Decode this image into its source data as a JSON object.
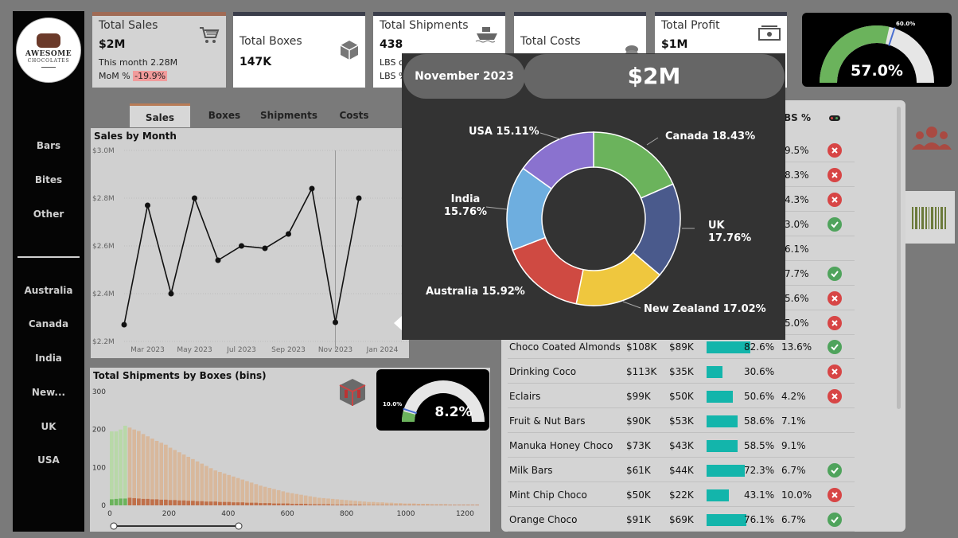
{
  "logo": {
    "line1": "AWESOME",
    "line2": "CHOCOLATES"
  },
  "nav": {
    "products": [
      "Bars",
      "Bites",
      "Other"
    ],
    "countries": [
      "Australia",
      "Canada",
      "India",
      "New...",
      "UK",
      "USA"
    ]
  },
  "kpis": {
    "sales": {
      "title": "Total Sales",
      "value": "$2M",
      "sub1": "This month 2.28M",
      "sub2_label": "MoM %",
      "sub2_value": "-19.9%"
    },
    "boxes": {
      "title": "Total Boxes",
      "value": "147K"
    },
    "shipments": {
      "title": "Total Shipments",
      "value": "438",
      "sub1": "LBS c",
      "sub2": "LBS %"
    },
    "costs": {
      "title": "Total Costs"
    },
    "profit": {
      "title": "Total Profit",
      "value": "$1M"
    }
  },
  "gauge_profit": {
    "value": "57.0%",
    "target": "60.0%",
    "fraction": 0.57,
    "target_fraction": 0.6,
    "color": "#6bb35c"
  },
  "tabs": [
    "Sales",
    "Boxes",
    "Shipments",
    "Costs"
  ],
  "line_chart": {
    "title": "Sales by Month",
    "y_ticks": [
      "$3.0M",
      "$2.8M",
      "$2.6M",
      "$2.4M",
      "$2.2M"
    ],
    "x_ticks": [
      "Mar 2023",
      "May 2023",
      "Jul 2023",
      "Sep 2023",
      "Nov 2023",
      "Jan 2024"
    ]
  },
  "hist_chart": {
    "title": "Total Shipments by Boxes (bins)",
    "y_ticks": [
      "300",
      "200",
      "100",
      "0"
    ],
    "x_ticks": [
      "0",
      "200",
      "400",
      "600",
      "800",
      "1000",
      "1200"
    ]
  },
  "gauge_ship": {
    "value": "8.2%",
    "target": "10.0%",
    "fraction": 0.082,
    "target_fraction": 0.1
  },
  "table": {
    "header_lbs": "BS %",
    "partial_rows": [
      {
        "lbs": "9.5%",
        "status": "bad"
      },
      {
        "lbs": "8.3%",
        "status": "bad"
      },
      {
        "lbs": "4.3%",
        "status": "bad"
      },
      {
        "lbs": "3.0%",
        "status": "good"
      },
      {
        "lbs": "6.1%",
        "status": "none"
      },
      {
        "lbs": "7.7%",
        "status": "good"
      },
      {
        "lbs": "5.6%",
        "status": "bad"
      },
      {
        "lbs": "5.0%",
        "status": "bad"
      }
    ],
    "rows": [
      {
        "product": "Choco Coated Almonds",
        "sales": "$108K",
        "profit": "$89K",
        "margin": "82.6%",
        "margin_value": 0.826,
        "lbs": "13.6%",
        "status": "good"
      },
      {
        "product": "Drinking Coco",
        "sales": "$113K",
        "profit": "$35K",
        "margin": "30.6%",
        "margin_value": 0.306,
        "lbs": "",
        "status": "bad"
      },
      {
        "product": "Eclairs",
        "sales": "$99K",
        "profit": "$50K",
        "margin": "50.6%",
        "margin_value": 0.506,
        "lbs": "4.2%",
        "status": "bad"
      },
      {
        "product": "Fruit & Nut Bars",
        "sales": "$90K",
        "profit": "$53K",
        "margin": "58.6%",
        "margin_value": 0.586,
        "lbs": "7.1%",
        "status": "none"
      },
      {
        "product": "Manuka Honey Choco",
        "sales": "$73K",
        "profit": "$43K",
        "margin": "58.5%",
        "margin_value": 0.585,
        "lbs": "9.1%",
        "status": "none"
      },
      {
        "product": "Milk Bars",
        "sales": "$61K",
        "profit": "$44K",
        "margin": "72.3%",
        "margin_value": 0.723,
        "lbs": "6.7%",
        "status": "good"
      },
      {
        "product": "Mint Chip Choco",
        "sales": "$50K",
        "profit": "$22K",
        "margin": "43.1%",
        "margin_value": 0.431,
        "lbs": "10.0%",
        "status": "bad"
      },
      {
        "product": "Orange Choco",
        "sales": "$91K",
        "profit": "$69K",
        "margin": "76.1%",
        "margin_value": 0.761,
        "lbs": "6.7%",
        "status": "good"
      }
    ]
  },
  "tooltip": {
    "month": "November 2023",
    "value": "$2M",
    "labels": {
      "usa": "USA 15.11%",
      "canada": "Canada 18.43%",
      "india_name": "India",
      "india_pct": "15.76%",
      "uk_name": "UK",
      "uk_pct": "17.76%",
      "australia": "Australia 15.92%",
      "nz": "New Zealand 17.02%"
    }
  },
  "chart_data": [
    {
      "type": "line",
      "title": "Sales by Month",
      "x": [
        "Feb 2023",
        "Mar 2023",
        "Apr 2023",
        "May 2023",
        "Jun 2023",
        "Jul 2023",
        "Aug 2023",
        "Sep 2023",
        "Oct 2023",
        "Nov 2023",
        "Dec 2023"
      ],
      "values": [
        2.27,
        2.77,
        2.4,
        2.8,
        2.54,
        2.6,
        2.59,
        2.65,
        2.84,
        2.28,
        2.8
      ],
      "ylim": [
        2.2,
        3.0
      ],
      "y_unit": "$M",
      "grid": true
    },
    {
      "type": "pie",
      "labels": [
        "Canada",
        "UK",
        "New Zealand",
        "Australia",
        "India",
        "USA"
      ],
      "values": [
        18.43,
        17.76,
        17.02,
        15.92,
        15.76,
        15.11
      ],
      "colors": [
        "#6bb35c",
        "#4a5a8c",
        "#efc73e",
        "#cf4a42",
        "#6eaedf",
        "#8a72cf"
      ]
    },
    {
      "type": "bar",
      "title": "Total Shipments by Boxes (bins)",
      "ylim": [
        0,
        300
      ],
      "xlim": [
        0,
        1250
      ],
      "series": [
        {
          "values": [
            195,
            195,
            200,
            210,
            205,
            200,
            196,
            188,
            182,
            176,
            170,
            165,
            160,
            152,
            146,
            140,
            134,
            128,
            122,
            116,
            110,
            104,
            98,
            92,
            88,
            84,
            80,
            76,
            72,
            68,
            64,
            60,
            56,
            52,
            49,
            46,
            43,
            40,
            37,
            34,
            32,
            30,
            28,
            26,
            24,
            22,
            20,
            19,
            18,
            17,
            16,
            15,
            14,
            13,
            12,
            11,
            10,
            9,
            9,
            8,
            8,
            7,
            7,
            6,
            6,
            5,
            5,
            5,
            4,
            4,
            4,
            3,
            3,
            3,
            3,
            2,
            2,
            2,
            2,
            2,
            2,
            2
          ]
        },
        {
          "values": [
            16,
            17,
            18,
            18,
            20,
            19,
            18,
            17,
            17,
            16,
            16,
            15,
            15,
            14,
            14,
            13,
            13,
            12,
            12,
            11,
            11,
            10,
            10,
            10,
            9,
            9,
            9,
            8,
            8,
            8,
            7,
            7,
            7,
            6,
            6,
            6,
            5,
            5,
            5,
            5,
            4,
            4,
            4,
            4,
            3,
            3,
            3,
            3,
            3,
            2,
            2,
            2,
            2,
            2,
            2,
            2,
            1,
            1,
            1,
            1,
            1,
            1,
            1,
            1,
            1,
            1,
            1,
            1,
            1,
            1,
            1,
            1,
            1,
            1,
            1,
            1,
            1,
            1,
            1,
            1,
            1,
            1
          ]
        }
      ]
    }
  ]
}
